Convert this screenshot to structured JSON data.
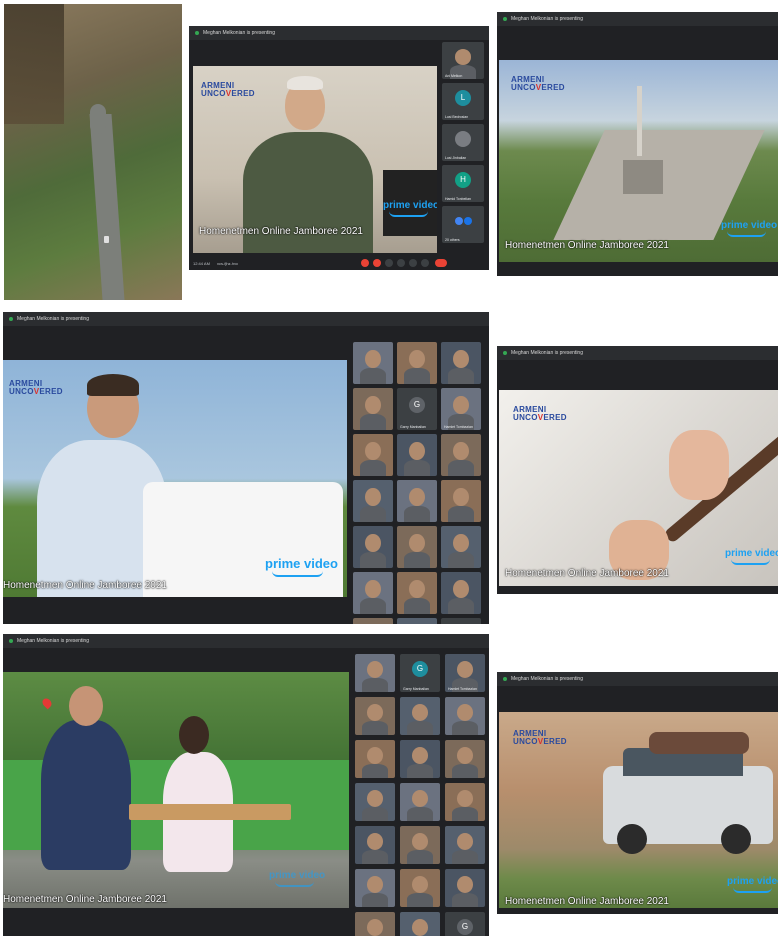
{
  "meeting": {
    "presenting_label": "Meghan Melkonian is presenting",
    "caption": "Homenetmen Online Jamboree 2021",
    "logo_line1": "ARMENI",
    "logo_line2": "UNCO",
    "logo_line2_o": "V",
    "logo_line2_end": "ERED",
    "prime_label": "prime video",
    "clock": "12:44 AM",
    "meeting_code": "xcs-fjhz-hvc"
  },
  "panel2": {
    "participants": [
      "Ani Melkon",
      "Lusi Bedrosian",
      "Lusi Jinbalian",
      "Hamid Tonbelian",
      "20 others"
    ],
    "avatar_letters": [
      "",
      "L",
      "",
      "H",
      ""
    ]
  },
  "panel4": {
    "participant_names": [
      "",
      "",
      "",
      "",
      "Garry Manbalian",
      "Hamlet Tombazian",
      "",
      "",
      "",
      "",
      "",
      "",
      "",
      "",
      "",
      "",
      "",
      "",
      "",
      "35 others",
      "You"
    ],
    "avatar_letters": [
      "",
      "",
      "",
      "",
      "G",
      "",
      "",
      "",
      "",
      "",
      "",
      "",
      "",
      "",
      "",
      "",
      "",
      "",
      "",
      "",
      "G"
    ]
  },
  "panel6": {
    "participant_names": [
      "",
      "Garry Manbalian",
      "Hamlet Tombazian",
      "",
      "",
      "",
      "",
      "",
      "",
      "",
      "",
      "",
      "",
      "",
      "",
      "",
      "",
      "",
      "",
      "35 others",
      "You"
    ],
    "avatar_letters": [
      "",
      "G",
      "",
      "",
      "",
      "",
      "",
      "",
      "",
      "",
      "",
      "",
      "",
      "",
      "",
      "",
      "",
      "",
      "",
      "",
      "G"
    ]
  },
  "colors": {
    "meet_bg": "#202124",
    "tile_bg": "#3c4043",
    "end_call": "#ea4335",
    "prime_blue": "#1da1f2",
    "logo_blue": "#2a4a9e",
    "logo_red": "#d9302c"
  }
}
